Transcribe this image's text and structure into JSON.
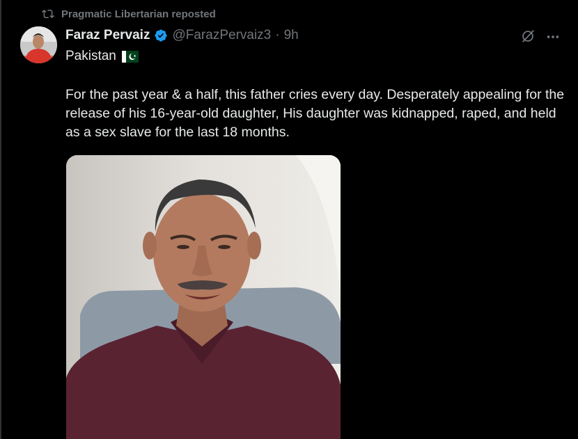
{
  "repost": {
    "label": "Pragmatic Libertarian reposted",
    "icon": "repost-icon"
  },
  "author": {
    "name": "Faraz Pervaiz",
    "handle": "@FarazPervaiz3",
    "separator": "·",
    "time": "9h"
  },
  "post": {
    "country_line": "Pakistan",
    "text": "For the past year & a half, this father cries every day. Desperately appealing for the release of his 16-year-old daughter, His daughter was kidnapped, raped, and held as a sex slave for the last 18 months."
  },
  "colors": {
    "background": "#000000",
    "text": "#e7e9ea",
    "muted": "#71767b",
    "verified": "#1d9bf0"
  }
}
